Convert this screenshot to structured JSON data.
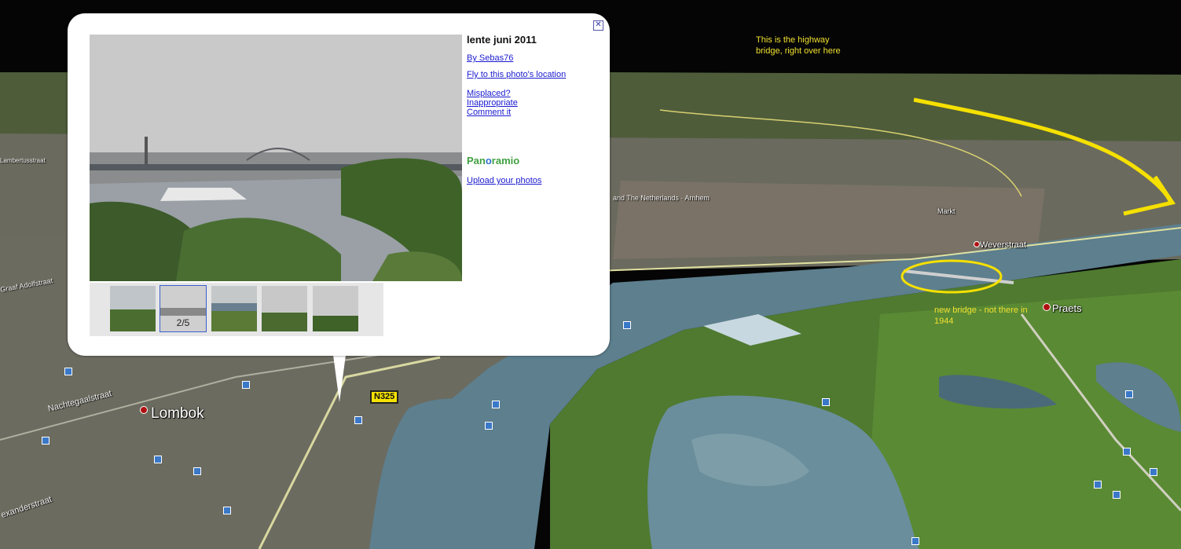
{
  "balloon": {
    "title": "lente juni 2011",
    "author_link": "By Sebas76",
    "fly_link": "Fly to this photo's location",
    "misplaced_link": "Misplaced?",
    "inappropriate_link": "Inappropriate",
    "comment_link": "Comment it",
    "logo_part1": "Pan",
    "logo_part2": "o",
    "logo_part3": "ramio",
    "upload_link": "Upload your photos",
    "thumb_counter": "2/5"
  },
  "map_labels": {
    "lombok": "Lombok",
    "weverstraat": "Weverstraat",
    "praets": "Praets",
    "markt": "Markt",
    "n325": "N325",
    "netherlands": "and The Netherlands · Arnhem",
    "road1": "Nachtegaalstraat",
    "road2": "exanderstraat",
    "road3": "Graaf Adolfstraat",
    "road4": "Lambertusstraat"
  },
  "annotations": {
    "highway_line1": "This is the highway",
    "highway_line2": "bridge, right over here",
    "newbridge_line1": "new bridge - not there in",
    "newbridge_line2": "1944"
  },
  "colors": {
    "annotation": "#f0e030",
    "link": "#1a1ad0",
    "river": "#5d7f8e"
  }
}
